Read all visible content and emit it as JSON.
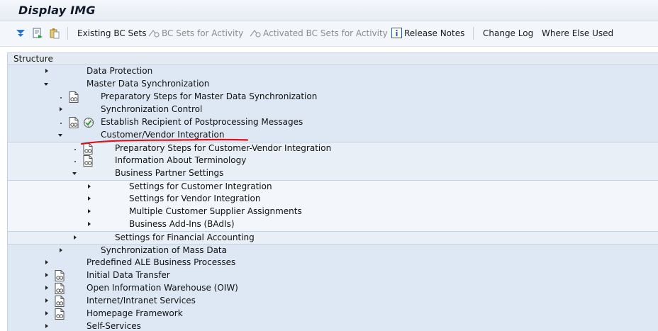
{
  "window": {
    "title": "Display IMG"
  },
  "toolbar": {
    "existing_bc_sets": "Existing BC Sets",
    "bc_sets_for_activity": "BC Sets for Activity",
    "activated_bc_sets_for_activity": "Activated BC Sets for Activity",
    "release_notes": "Release Notes",
    "change_log": "Change Log",
    "where_else_used": "Where Else Used"
  },
  "tree": {
    "header": "Structure",
    "nodes": [
      {
        "label": "Data Protection",
        "state": "collapsed",
        "level": 0
      },
      {
        "label": "Master Data Synchronization",
        "state": "expanded",
        "level": 0
      },
      {
        "label": "Preparatory Steps for Master Data Synchronization",
        "state": "leaf",
        "level": 1
      },
      {
        "label": "Synchronization Control",
        "state": "collapsed",
        "level": 1
      },
      {
        "label": "Establish Recipient of Postprocessing Messages",
        "state": "leaf",
        "level": 1
      },
      {
        "label": "Customer/Vendor Integration",
        "state": "expanded",
        "level": 1
      },
      {
        "label": "Preparatory Steps for Customer-Vendor Integration",
        "state": "leaf",
        "level": 2
      },
      {
        "label": "Information About Terminology",
        "state": "leaf",
        "level": 2
      },
      {
        "label": "Business Partner Settings",
        "state": "expanded",
        "level": 2
      },
      {
        "label": "Settings for Customer Integration",
        "state": "collapsed",
        "level": 3
      },
      {
        "label": "Settings for Vendor Integration",
        "state": "collapsed",
        "level": 3
      },
      {
        "label": "Multiple Customer Supplier Assignments",
        "state": "collapsed",
        "level": 3
      },
      {
        "label": "Business Add-Ins (BAdIs)",
        "state": "collapsed",
        "level": 3
      },
      {
        "label": "Settings for Financial Accounting",
        "state": "collapsed",
        "level": 2
      },
      {
        "label": "Synchronization of Mass Data",
        "state": "collapsed",
        "level": 1
      },
      {
        "label": "Predefined ALE Business Processes",
        "state": "collapsed",
        "level": 0
      },
      {
        "label": "Initial Data Transfer",
        "state": "collapsed",
        "level": 0
      },
      {
        "label": "Open Information Warehouse (OIW)",
        "state": "collapsed",
        "level": 0
      },
      {
        "label": "Internet/Intranet Services",
        "state": "collapsed",
        "level": 0
      },
      {
        "label": "Homepage Framework",
        "state": "collapsed",
        "level": 0
      },
      {
        "label": "Self-Services",
        "state": "collapsed",
        "level": 0
      }
    ]
  },
  "colors": {
    "annotation": "#d9141b",
    "header_bg": "#e3eaf2",
    "level0_bg": "#dde8f4"
  }
}
